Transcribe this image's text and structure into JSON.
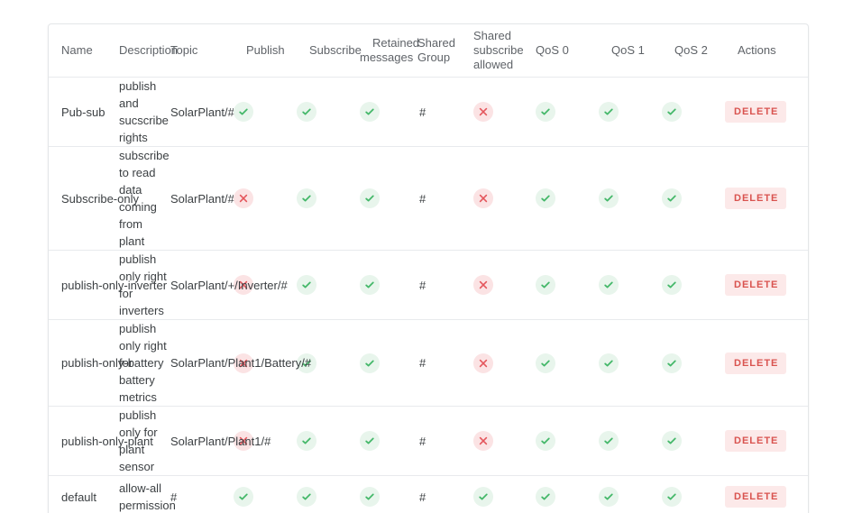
{
  "table": {
    "columns": [
      {
        "key": "name",
        "label": "Name"
      },
      {
        "key": "desc",
        "label": "Description"
      },
      {
        "key": "topic",
        "label": "Topic"
      },
      {
        "key": "publish",
        "label": "Publish"
      },
      {
        "key": "subscribe",
        "label": "Subscribe"
      },
      {
        "key": "retained",
        "label": "Retained messages"
      },
      {
        "key": "sgroup",
        "label": "Shared Group"
      },
      {
        "key": "ssub",
        "label": "Shared subscribe allowed"
      },
      {
        "key": "qos0",
        "label": "QoS 0"
      },
      {
        "key": "qos1",
        "label": "QoS 1"
      },
      {
        "key": "qos2",
        "label": "QoS 2"
      },
      {
        "key": "actions",
        "label": "Actions"
      }
    ],
    "delete_label": "DELETE",
    "rows": [
      {
        "name": "Pub-sub",
        "desc": "publish and sucscribe rights",
        "topic": "SolarPlant/#",
        "publish": "yes",
        "subscribe": "yes",
        "retained": "yes",
        "sgroup": "#",
        "ssub": "no",
        "qos0": "yes",
        "qos1": "yes",
        "qos2": "yes"
      },
      {
        "name": "Subscribe-only",
        "desc": "subscribe to read data coming from plant",
        "topic": "SolarPlant/#",
        "publish": "no",
        "subscribe": "yes",
        "retained": "yes",
        "sgroup": "#",
        "ssub": "no",
        "qos0": "yes",
        "qos1": "yes",
        "qos2": "yes"
      },
      {
        "name": "publish-only-inverter",
        "desc": "publish only right for inverters",
        "topic": "SolarPlant/+/Inverter/#",
        "publish": "no",
        "subscribe": "yes",
        "retained": "yes",
        "sgroup": "#",
        "ssub": "no",
        "qos0": "yes",
        "qos1": "yes",
        "qos2": "yes"
      },
      {
        "name": "publish-only-battery",
        "desc": "publish only right for battery metrics",
        "topic": "SolarPlant/Plant1/Battery/#",
        "publish": "no",
        "subscribe": "yes",
        "retained": "yes",
        "sgroup": "#",
        "ssub": "no",
        "qos0": "yes",
        "qos1": "yes",
        "qos2": "yes"
      },
      {
        "name": "publish-only-plant",
        "desc": "publish only for plant sensor",
        "topic": "SolarPlant/Plant1/#",
        "publish": "no",
        "subscribe": "yes",
        "retained": "yes",
        "sgroup": "#",
        "ssub": "no",
        "qos0": "yes",
        "qos1": "yes",
        "qos2": "yes"
      },
      {
        "name": "default",
        "desc": "allow-all permission",
        "topic": "#",
        "publish": "yes",
        "subscribe": "yes",
        "retained": "yes",
        "sgroup": "#",
        "ssub": "yes",
        "qos0": "yes",
        "qos1": "yes",
        "qos2": "yes"
      }
    ]
  },
  "icons": {
    "yes": "check-icon",
    "no": "cross-icon"
  },
  "colors": {
    "check_green": "#45b86a",
    "check_bg": "#e8f5ec",
    "cross_red": "#e4565c",
    "cross_bg": "#fbe3e4",
    "delete_text": "#d9534f",
    "delete_bg": "#fce9e9",
    "header_text": "#5f6368",
    "body_text": "#3c4043",
    "border": "#e8eaed"
  }
}
